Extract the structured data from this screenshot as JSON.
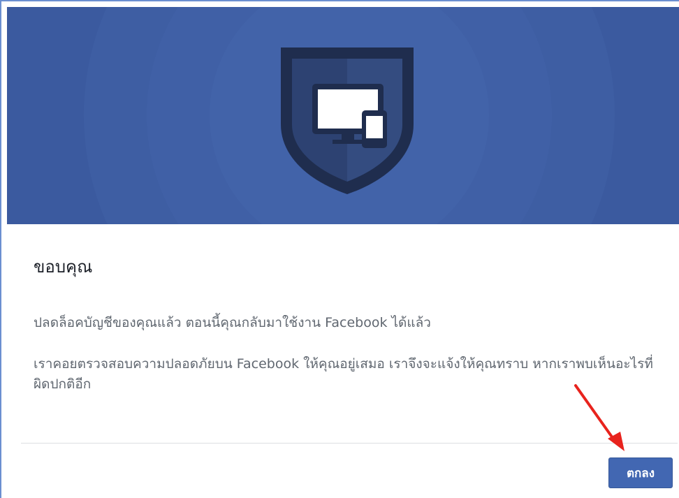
{
  "dialog": {
    "title": "ขอบคุณ",
    "paragraph1": "ปลดล็อคบัญชีของคุณแล้ว ตอนนี้คุณกลับมาใช้งาน Facebook ได้แล้ว",
    "paragraph2": "เราคอยตรวจสอบความปลอดภัยบน Facebook ให้คุณอยู่เสมอ เราจึงจะแจ้งให้คุณทราบ หากเราพบเห็นอะไรที่ผิดปกติอีก",
    "ok_button_label": "ตกลง"
  },
  "banner": {
    "icon": "shield-device-icon"
  },
  "colors": {
    "banner": "#3b5a9f",
    "shield_dark": "#1f2d4e",
    "button": "#4267b2",
    "arrow": "#e8231d"
  }
}
